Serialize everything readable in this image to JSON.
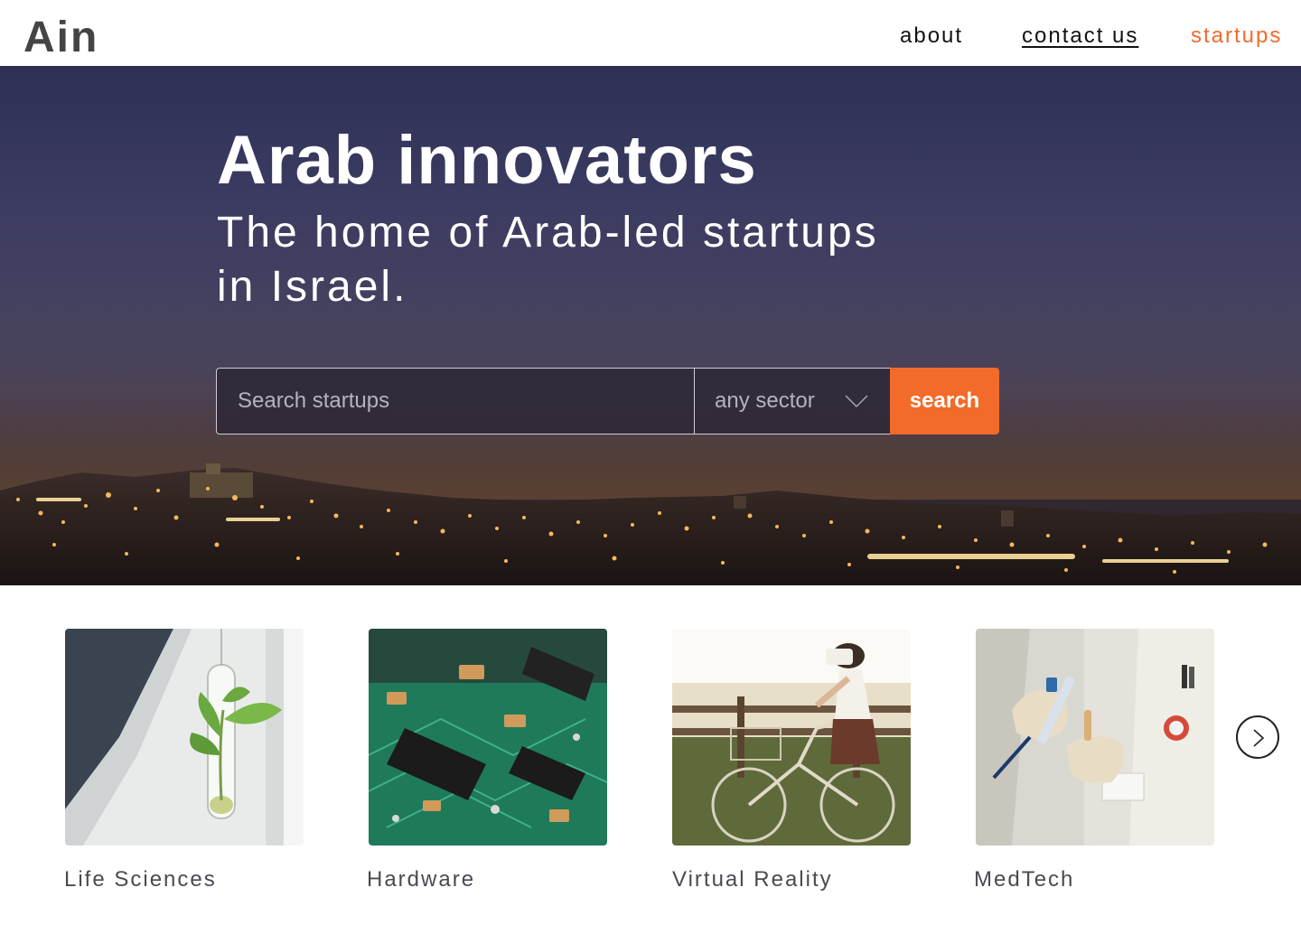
{
  "header": {
    "logo": "Ain",
    "nav": {
      "about": "about",
      "contact": "contact us",
      "startups": "startups"
    }
  },
  "hero": {
    "title": "Arab innovators",
    "subtitle_line1": "The home of Arab-led startups",
    "subtitle_line2": "in Israel.",
    "search": {
      "placeholder": "Search startups",
      "value": "",
      "sector_selected": "any sector",
      "button_label": "search"
    }
  },
  "sectors": [
    {
      "name": "Life Sciences",
      "image": "plant-in-test-tube"
    },
    {
      "name": "Hardware",
      "image": "circuit-board"
    },
    {
      "name": "Virtual Reality",
      "image": "vr-headset-bicycle"
    },
    {
      "name": "MedTech",
      "image": "lab-coat-pipette"
    }
  ],
  "colors": {
    "accent": "#f26b2a",
    "logo": "#444444",
    "text": "#111111"
  },
  "icons": {
    "dropdown": "chevron-down-icon",
    "next": "chevron-right-icon"
  }
}
